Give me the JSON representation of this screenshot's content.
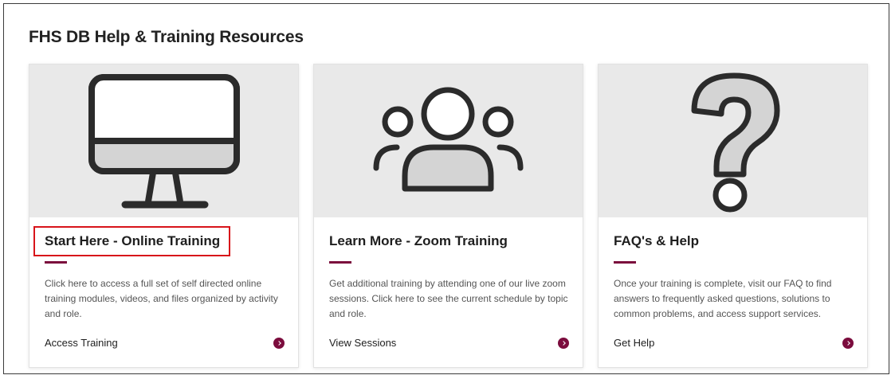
{
  "page": {
    "title": "FHS DB Help & Training Resources"
  },
  "colors": {
    "accent": "#7b0c3d",
    "hero_bg": "#e9e9e9",
    "icon_stroke": "#2b2b2b",
    "icon_fill": "#d4d4d4",
    "highlight": "#d8141a"
  },
  "cards": [
    {
      "icon": "monitor-icon",
      "title": "Start Here - Online Training",
      "description": "Click here to access a full set of self directed online training modules, videos, and files organized by activity and role.",
      "link_label": "Access Training",
      "highlighted": true
    },
    {
      "icon": "users-group-icon",
      "title": "Learn More - Zoom Training",
      "description": "Get additional training by attending one of our live zoom sessions.  Click here to see the current schedule by topic and role.",
      "link_label": "View Sessions",
      "highlighted": false
    },
    {
      "icon": "question-mark-icon",
      "title": "FAQ's & Help",
      "description": "Once your training is complete, visit our FAQ to find answers to frequently asked questions, solutions to common problems, and access support services.",
      "link_label": "Get Help",
      "highlighted": false
    }
  ]
}
